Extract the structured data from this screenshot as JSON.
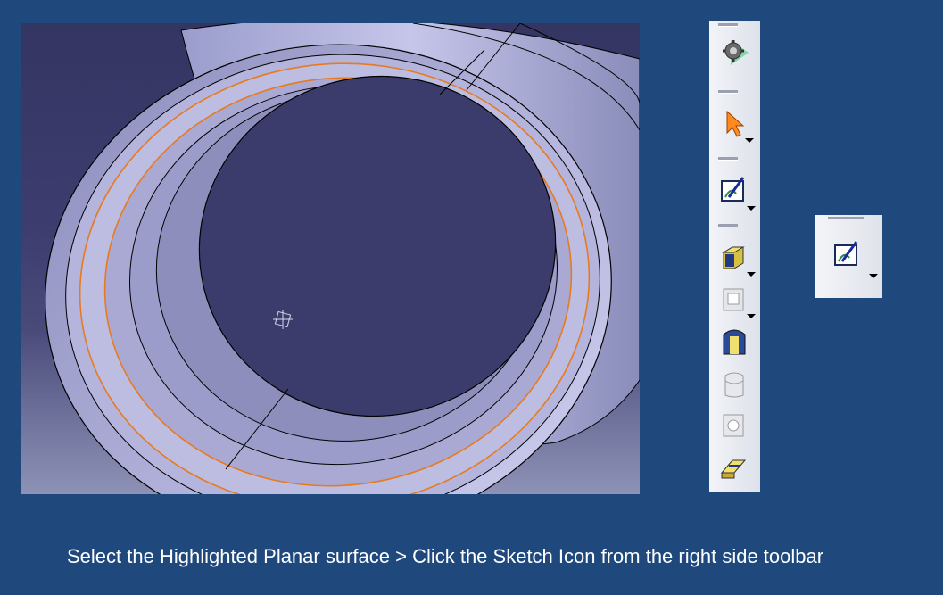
{
  "caption": "Select the Highlighted Planar surface > Click the Sketch Icon from the right side toolbar",
  "viewport": {
    "highlight_color": "#e87a1e",
    "part_color": "#b9b9e0"
  },
  "toolbar": {
    "items": [
      {
        "icon": "gear-icon"
      },
      {
        "icon": "select-arrow-icon"
      },
      {
        "icon": "sketch-icon"
      },
      {
        "icon": "pad-icon"
      },
      {
        "icon": "pocket-icon"
      },
      {
        "icon": "shaft-icon"
      },
      {
        "icon": "groove-icon"
      },
      {
        "icon": "hole-icon"
      },
      {
        "icon": "rib-icon"
      }
    ]
  },
  "zoomed_icon": {
    "icon": "sketch-icon"
  }
}
